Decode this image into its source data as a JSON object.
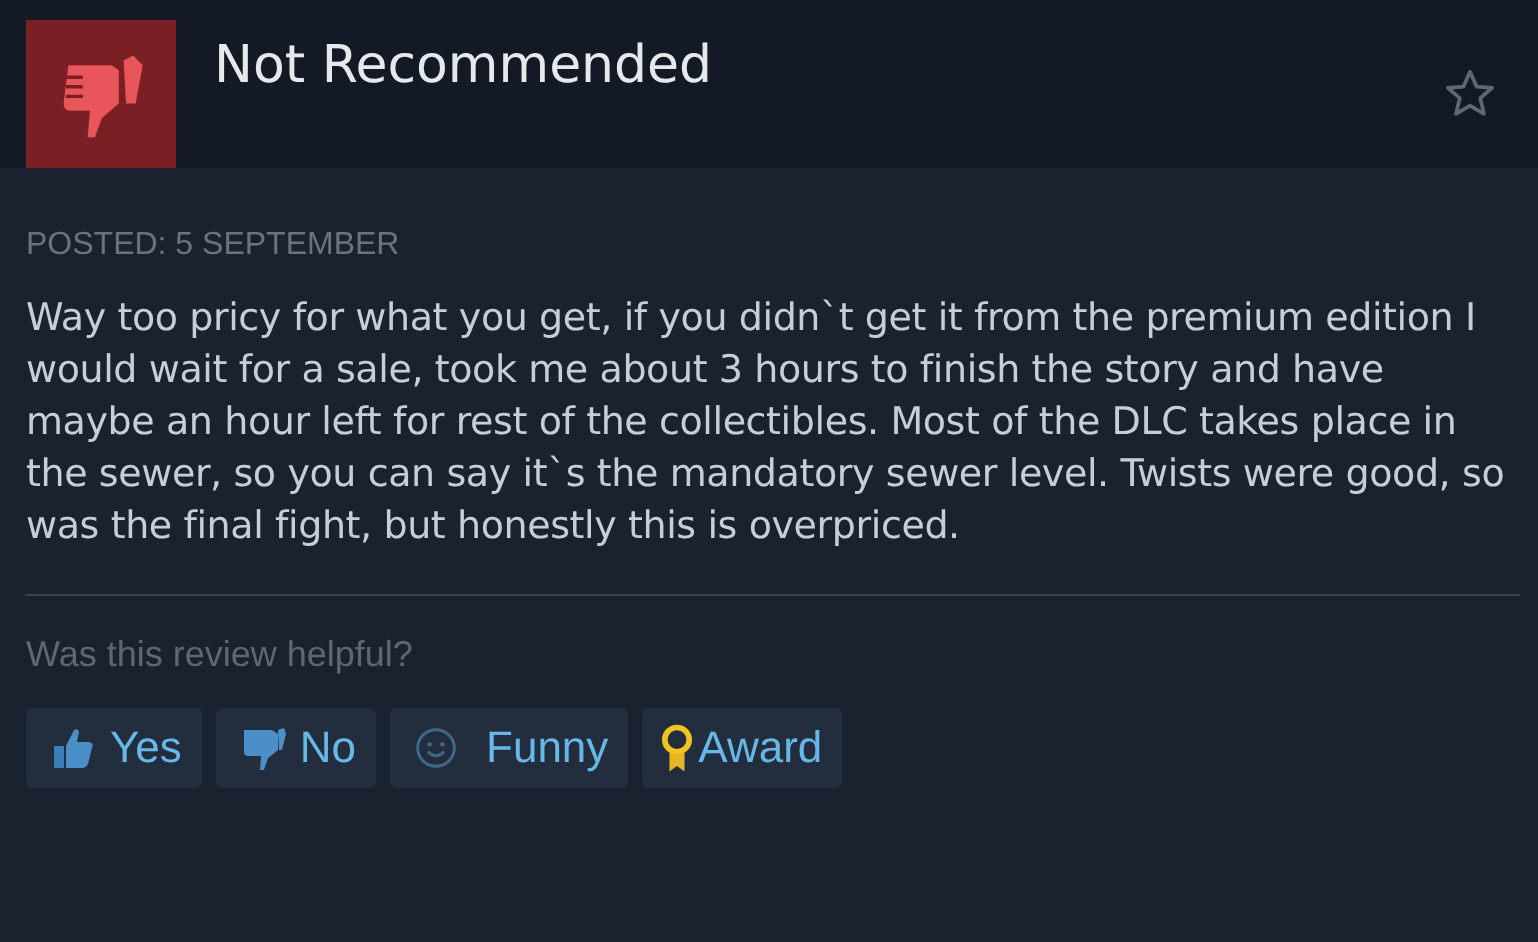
{
  "review": {
    "verdict": "Not Recommended",
    "posted": "POSTED: 5 SEPTEMBER",
    "text": "Way too pricy for what you get, if you didn`t get it from the premium edition I would wait for a sale, took me about 3 hours to finish the story and have maybe an hour left for rest of the collectibles. Most of the DLC takes place in the sewer, so you can say it`s the mandatory sewer level. Twists were good, so was the final fight, but honestly this is overpriced."
  },
  "helpful": {
    "prompt": "Was this review helpful?",
    "buttons": [
      {
        "kind": "yes",
        "label": "Yes"
      },
      {
        "kind": "no",
        "label": "No"
      },
      {
        "kind": "funny",
        "label": "Funny"
      },
      {
        "kind": "award",
        "label": "Award"
      }
    ]
  }
}
